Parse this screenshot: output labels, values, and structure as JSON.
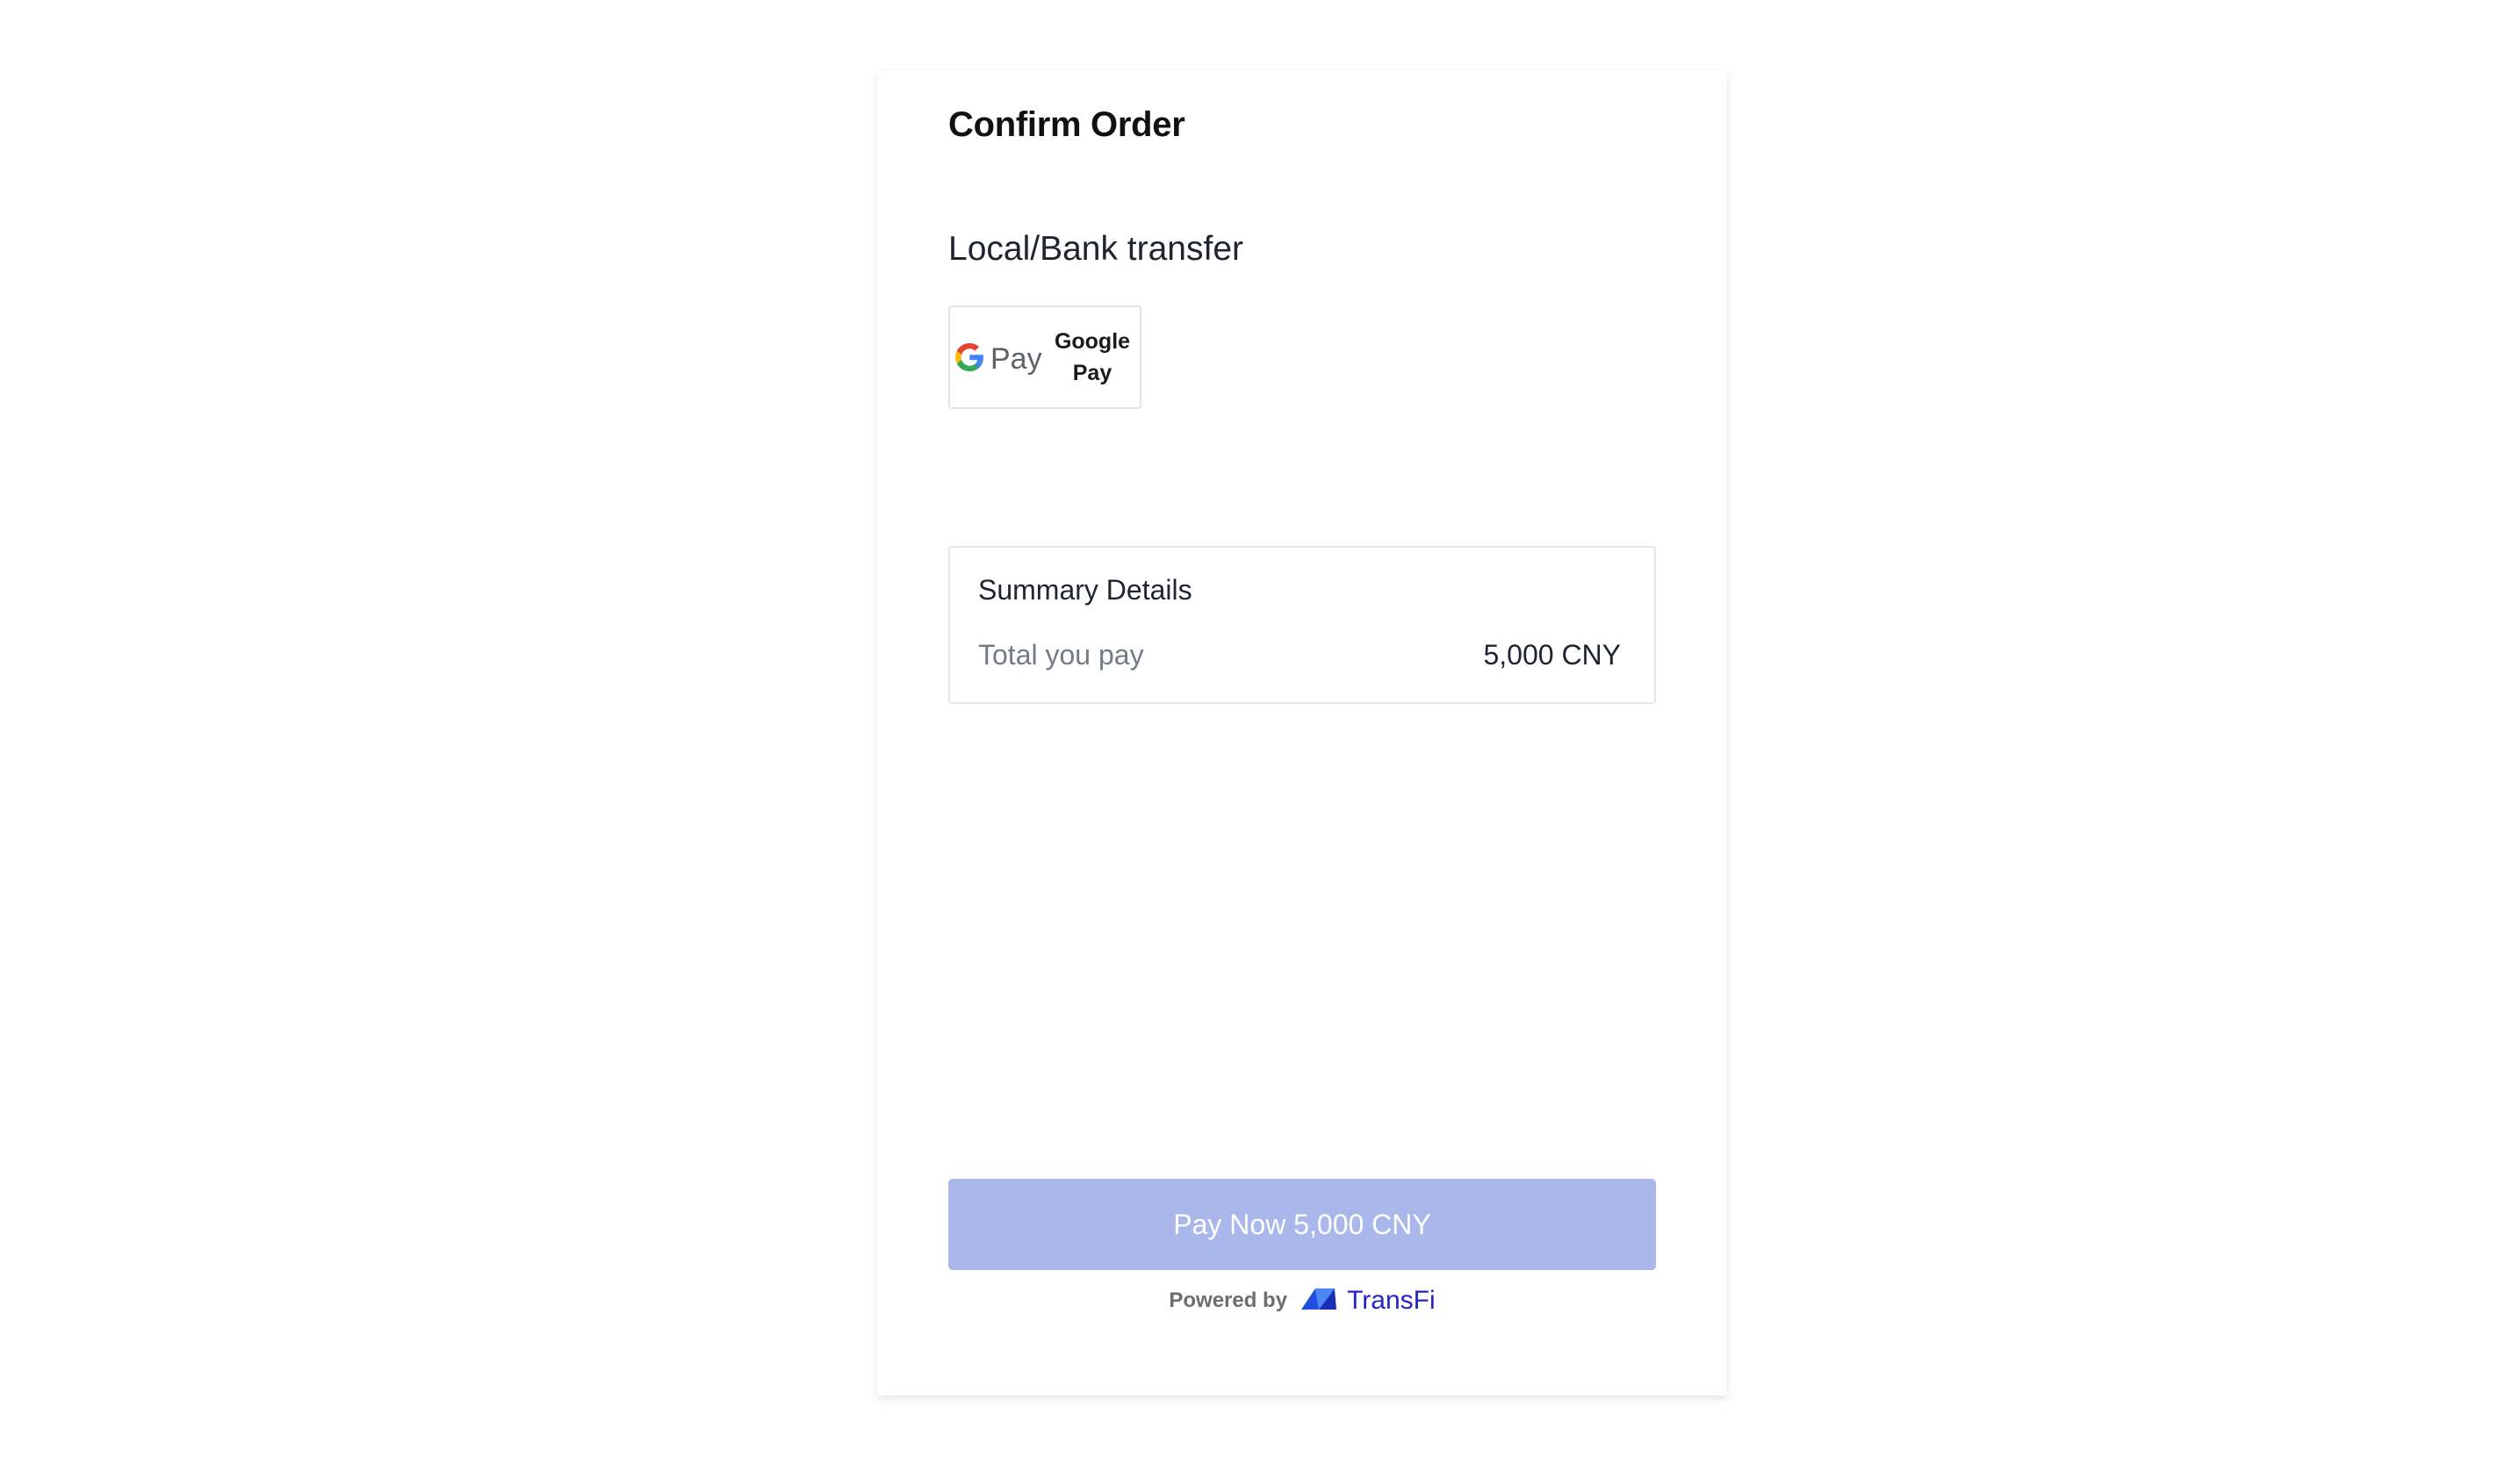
{
  "page": {
    "title": "Confirm Order"
  },
  "payment_section": {
    "title": "Local/Bank transfer",
    "methods": [
      {
        "label": "Google Pay",
        "logo_text": "Pay",
        "icon": "google-pay-icon"
      }
    ]
  },
  "summary": {
    "title": "Summary Details",
    "total_label": "Total you pay",
    "total_value": "5,000 CNY"
  },
  "pay_button": {
    "label": "Pay Now 5,000 CNY",
    "state": "disabled"
  },
  "footer": {
    "powered_by": "Powered by",
    "brand_name": "TransFi",
    "brand_icon": "transfi-logo-icon"
  },
  "colors": {
    "button_bg": "#a9b7ea",
    "brand": "#2323c8",
    "muted_text": "#737b86"
  }
}
